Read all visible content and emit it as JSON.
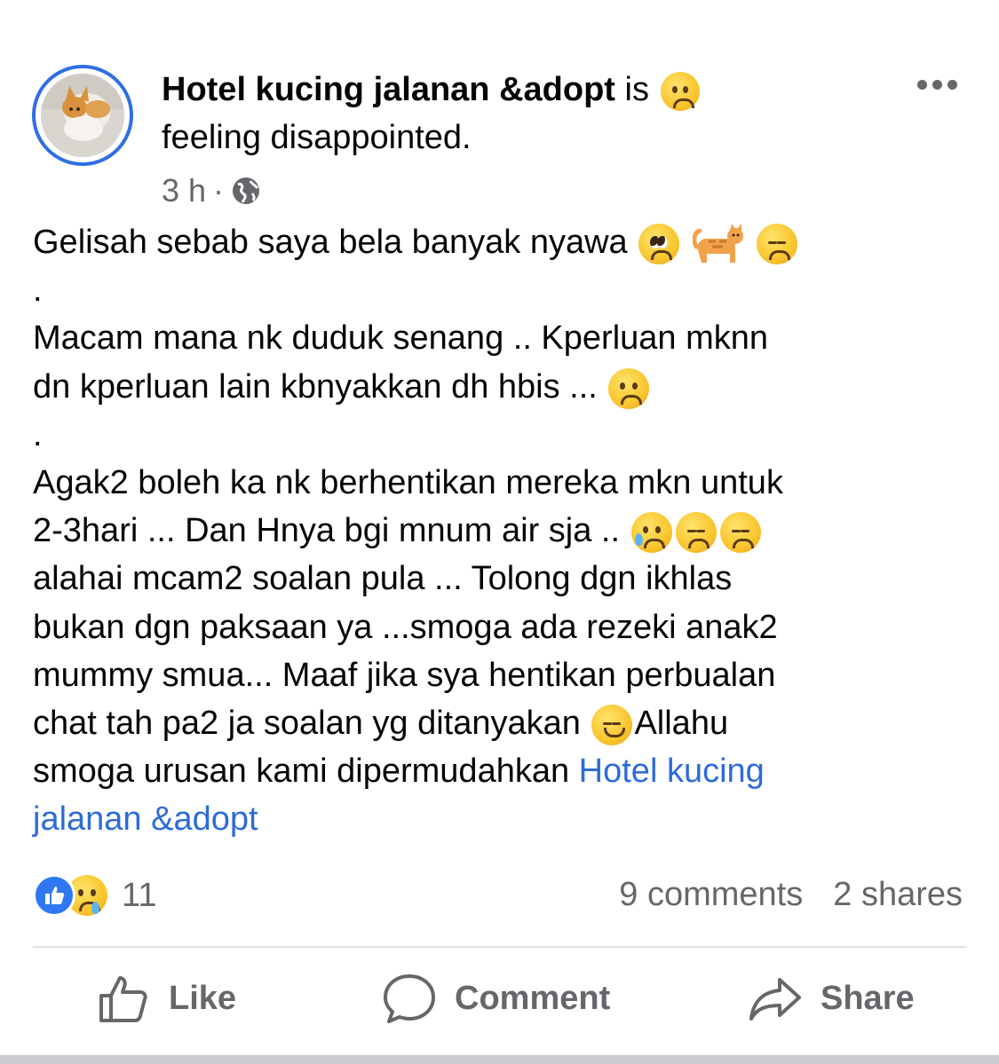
{
  "post": {
    "author": "Hotel kucing jalanan &adopt",
    "is_text": "is",
    "feeling": "feeling disappointed.",
    "time": "3 h",
    "separator": "·",
    "lines": [
      {
        "text": "Gelisah sebab saya bela banyak nyawa"
      },
      {
        "text": "."
      },
      {
        "text": "Macam mana nk duduk senang .. Kperluan mknn"
      },
      {
        "text": "dn kperluan lain kbnyakkan dh hbis ..."
      },
      {
        "text": "."
      },
      {
        "text": "Agak2 boleh ka nk berhentikan mereka  mkn untuk"
      },
      {
        "text": "2-3hari ... Dan Hnya bgi mnum air sja .."
      },
      {
        "text": "alahai mcam2 soalan pula ... Tolong dgn ikhlas"
      },
      {
        "text": "bukan dgn paksaan ya ...smoga ada rezeki anak2"
      },
      {
        "text": "mummy smua... Maaf jika sya hentikan perbualan"
      },
      {
        "text": "chat tah pa2 ja soalan yg ditanyakan"
      },
      {
        "text": "Allahu"
      },
      {
        "text": "smoga urusan kami dipermudahkan"
      },
      {
        "text": "Hotel kucing"
      },
      {
        "text": "jalanan &adopt"
      }
    ]
  },
  "stats": {
    "reaction_count": "11",
    "comments": "9 comments",
    "shares": "2 shares"
  },
  "actions": {
    "like": "Like",
    "comment": "Comment",
    "share": "Share"
  },
  "colors": {
    "accent": "#2f6fe4",
    "link": "#2d6cd6",
    "muted": "#65676b"
  }
}
